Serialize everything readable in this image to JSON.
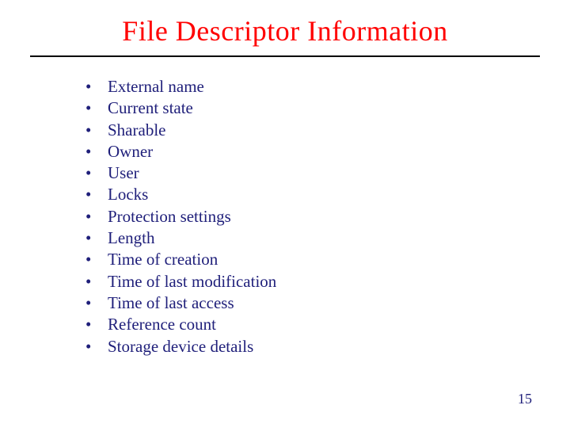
{
  "title": "File Descriptor Information",
  "bullets": [
    "External name",
    "Current state",
    "Sharable",
    "Owner",
    "User",
    "Locks",
    "Protection settings",
    "Length",
    "Time of creation",
    "Time of last modification",
    "Time of last access",
    "Reference count",
    "Storage device details"
  ],
  "page_number": "15"
}
